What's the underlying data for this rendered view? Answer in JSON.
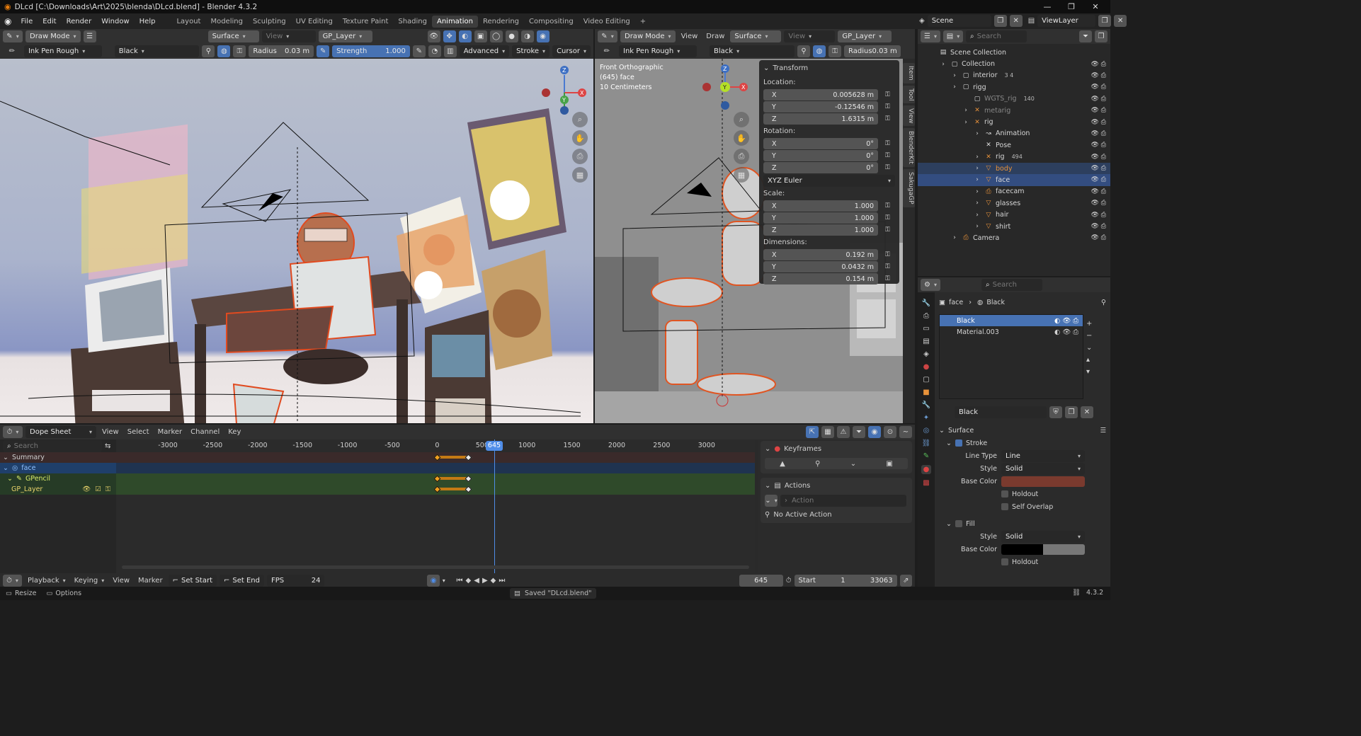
{
  "window": {
    "title": "DLcd [C:\\Downloads\\Art\\2025\\blenda\\DLcd.blend] - Blender 4.3.2",
    "scene": "Scene",
    "view_layer": "ViewLayer"
  },
  "menu": [
    "File",
    "Edit",
    "Render",
    "Window",
    "Help"
  ],
  "workspaces": [
    "Layout",
    "Modeling",
    "Sculpting",
    "UV Editing",
    "Texture Paint",
    "Shading",
    "Animation",
    "Rendering",
    "Compositing",
    "Video Editing"
  ],
  "active_workspace": "Animation",
  "viewport_left": {
    "mode": "Draw Mode",
    "placement": "Surface",
    "view_label": "View",
    "layer": "GP_Layer",
    "brush": "Ink Pen Rough",
    "material": "Black",
    "radius_label": "Radius",
    "radius_value": "0.03 m",
    "strength_label": "Strength",
    "strength_value": "1.000",
    "advanced": "Advanced",
    "stroke": "Stroke",
    "cursor": "Cursor"
  },
  "viewport_right": {
    "mode": "Draw Mode",
    "view_menu": "View",
    "draw_menu": "Draw",
    "placement": "Surface",
    "view_label": "View",
    "layer": "GP_Layer",
    "brush": "Ink Pen Rough",
    "material": "Black",
    "radius_label": "Radius",
    "radius_value": "0.03 m",
    "overlay_line1": "Front Orthographic",
    "overlay_line2": "(645) face",
    "overlay_line3": "10 Centimeters"
  },
  "transform": {
    "title": "Transform",
    "location_label": "Location:",
    "location": [
      {
        "axis": "X",
        "value": "0.005628 m"
      },
      {
        "axis": "Y",
        "value": "-0.12546 m"
      },
      {
        "axis": "Z",
        "value": "1.6315 m"
      }
    ],
    "rotation_label": "Rotation:",
    "rotation": [
      {
        "axis": "X",
        "value": "0°"
      },
      {
        "axis": "Y",
        "value": "0°"
      },
      {
        "axis": "Z",
        "value": "0°"
      }
    ],
    "rotation_mode": "XYZ Euler",
    "scale_label": "Scale:",
    "scale": [
      {
        "axis": "X",
        "value": "1.000"
      },
      {
        "axis": "Y",
        "value": "1.000"
      },
      {
        "axis": "Z",
        "value": "1.000"
      }
    ],
    "dimensions_label": "Dimensions:",
    "dimensions": [
      {
        "axis": "X",
        "value": "0.192 m"
      },
      {
        "axis": "Y",
        "value": "0.0432 m"
      },
      {
        "axis": "Z",
        "value": "0.154 m"
      }
    ]
  },
  "side_tabs": [
    "Item",
    "Tool",
    "View",
    "BlenderKit",
    "SakugaGP"
  ],
  "outliner": {
    "search_placeholder": "Search",
    "items": [
      {
        "label": "Scene Collection",
        "indent": 0,
        "icon": "scene-collection",
        "badge": ""
      },
      {
        "label": "Collection",
        "indent": 1,
        "icon": "collection",
        "badge": ""
      },
      {
        "label": "interior",
        "indent": 2,
        "icon": "collection",
        "badge": "3 4"
      },
      {
        "label": "rigg",
        "indent": 2,
        "icon": "collection",
        "badge": ""
      },
      {
        "label": "WGTS_rig",
        "indent": 3,
        "icon": "collection",
        "badge": "140"
      },
      {
        "label": "metarig",
        "indent": 3,
        "icon": "armature",
        "badge": ""
      },
      {
        "label": "rig",
        "indent": 3,
        "icon": "armature",
        "badge": ""
      },
      {
        "label": "Animation",
        "indent": 4,
        "icon": "action",
        "badge": ""
      },
      {
        "label": "Pose",
        "indent": 4,
        "icon": "pose",
        "badge": ""
      },
      {
        "label": "rig",
        "indent": 4,
        "icon": "armature",
        "badge": "494"
      },
      {
        "label": "body",
        "indent": 4,
        "icon": "gpencil",
        "badge": ""
      },
      {
        "label": "face",
        "indent": 4,
        "icon": "gpencil",
        "badge": ""
      },
      {
        "label": "facecam",
        "indent": 4,
        "icon": "camera",
        "badge": ""
      },
      {
        "label": "glasses",
        "indent": 4,
        "icon": "gpencil",
        "badge": ""
      },
      {
        "label": "hair",
        "indent": 4,
        "icon": "gpencil",
        "badge": ""
      },
      {
        "label": "shirt",
        "indent": 4,
        "icon": "gpencil",
        "badge": ""
      },
      {
        "label": "Camera",
        "indent": 2,
        "icon": "camera",
        "badge": ""
      }
    ],
    "selected": "face"
  },
  "properties": {
    "search_placeholder": "Search",
    "breadcrumb_object": "face",
    "breadcrumb_material": "Black",
    "slots": [
      "Black",
      "Material.003"
    ],
    "material_name": "Black",
    "surface_label": "Surface",
    "stroke_label": "Stroke",
    "line_type_label": "Line Type",
    "line_type": "Line",
    "style_label": "Style",
    "style": "Solid",
    "base_color_label": "Base Color",
    "stroke_color": "#7a3a2e",
    "holdout_label": "Holdout",
    "self_overlap_label": "Self Overlap",
    "fill_label": "Fill",
    "fill_style_label": "Style",
    "fill_style": "Solid",
    "fill_base_color_label": "Base Color",
    "fill_holdout_label": "Holdout"
  },
  "dopesheet": {
    "editor": "Dope Sheet",
    "menus": [
      "View",
      "Select",
      "Marker",
      "Channel",
      "Key"
    ],
    "search_placeholder": "Search",
    "ticks": [
      "-3000",
      "-2500",
      "-2000",
      "-1500",
      "-1000",
      "-500",
      "0",
      "500",
      "1000",
      "1500",
      "2000",
      "2500",
      "3000"
    ],
    "current_frame": "645",
    "channels": [
      "Summary",
      "face",
      "GPencil",
      "GP_Layer"
    ],
    "keyframes_panel": "Keyframes",
    "actions_panel": "Actions",
    "action_placeholder": "Action",
    "no_action": "No Active Action"
  },
  "timeline": {
    "playback": "Playback",
    "keying": "Keying",
    "view": "View",
    "marker": "Marker",
    "set_start": "Set Start",
    "set_end": "Set End",
    "fps_label": "FPS",
    "fps": "24",
    "frame": "645",
    "start_label": "Start",
    "start": "1",
    "end": "33063"
  },
  "statusbar": {
    "resize": "Resize",
    "options": "Options",
    "saved": "Saved \"DLcd.blend\"",
    "version": "4.3.2"
  }
}
